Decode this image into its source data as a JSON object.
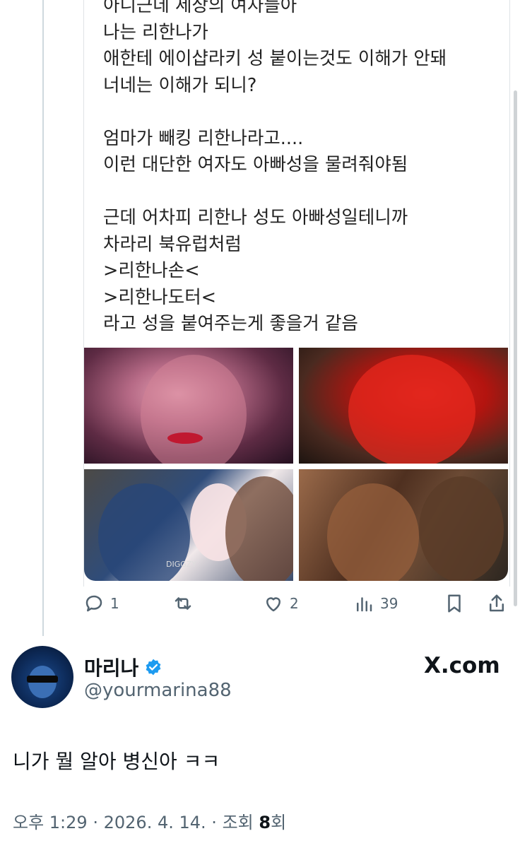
{
  "quoted_tweet": {
    "text_lines": [
      "아니근데 세상의 여자들아",
      "나는 리한나가",
      "애한테 에이샵라키 성 붙이는것도 이해가 안돼",
      "너네는 이해가 되니?",
      "",
      "엄마가 빼킹 리한나라고....",
      "이런 대단한 여자도 아빠성을 물려줘야됨",
      "",
      "근데 어차피 리한나 성도 아빠성일테니까",
      "차라리 북유럽처럼",
      ">리한나손<",
      ">리한나도터<",
      "라고 성을 붙여주는게 좋을거 같음"
    ],
    "media": [
      {
        "alt": "photo-1",
        "icon": "photo"
      },
      {
        "alt": "photo-2",
        "icon": "photo"
      },
      {
        "alt": "photo-3",
        "icon": "photo",
        "watermark": "DIGGZY"
      },
      {
        "alt": "photo-4",
        "icon": "photo"
      }
    ],
    "actions": {
      "replies": "1",
      "retweets": "",
      "likes": "2",
      "views": "39"
    }
  },
  "reply": {
    "display_name": "마리나",
    "handle": "@yourmarina88",
    "verified": true,
    "brand": "X.com",
    "text": "니가 뭘 알아 병신아 ㅋㅋ",
    "meta": {
      "time": "오후 1:29",
      "separator": "·",
      "date": "2026. 4. 14.",
      "views_prefix": "조회",
      "views_count": "8",
      "views_suffix": "회"
    }
  },
  "colors": {
    "text_primary": "#0f1419",
    "text_secondary": "#536471",
    "verified_blue": "#1d9bf0",
    "border": "#cfd9de"
  }
}
